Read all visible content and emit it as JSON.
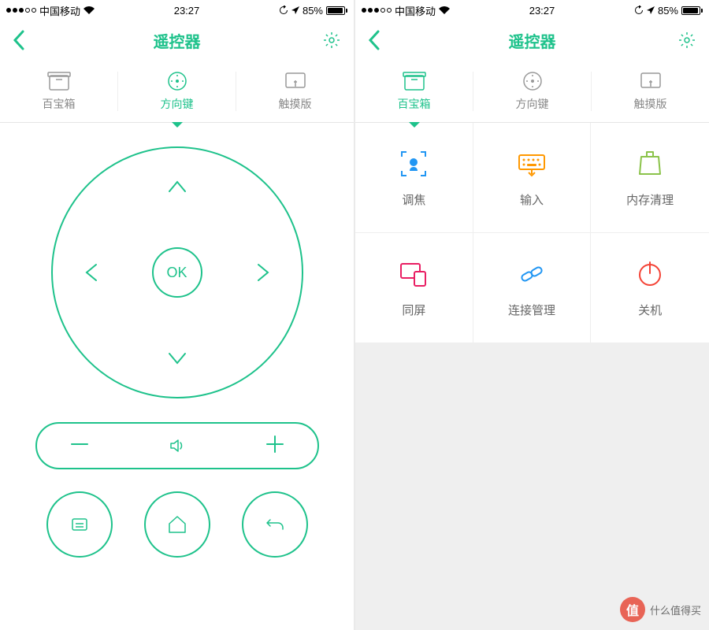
{
  "status": {
    "carrier": "中国移动",
    "time": "23:27",
    "battery_pct": "85%"
  },
  "header": {
    "title": "遥控器"
  },
  "tabs": [
    {
      "label": "百宝箱",
      "icon": "box-icon"
    },
    {
      "label": "方向键",
      "icon": "dpad-icon"
    },
    {
      "label": "触摸版",
      "icon": "touchpad-icon"
    }
  ],
  "left_screen": {
    "active_tab": "方向键",
    "dpad": {
      "ok_label": "OK"
    }
  },
  "right_screen": {
    "active_tab": "百宝箱",
    "tools": [
      {
        "label": "调焦",
        "icon": "focus-icon",
        "color": "#2196f3"
      },
      {
        "label": "输入",
        "icon": "keyboard-icon",
        "color": "#ff9800"
      },
      {
        "label": "内存清理",
        "icon": "clean-icon",
        "color": "#8bc34a"
      },
      {
        "label": "同屏",
        "icon": "mirror-icon",
        "color": "#e91e63"
      },
      {
        "label": "连接管理",
        "icon": "link-icon",
        "color": "#2196f3"
      },
      {
        "label": "关机",
        "icon": "power-icon",
        "color": "#f44336"
      }
    ]
  },
  "colors": {
    "accent": "#1ec28b"
  },
  "watermark": {
    "badge": "值",
    "text": "什么值得买"
  }
}
